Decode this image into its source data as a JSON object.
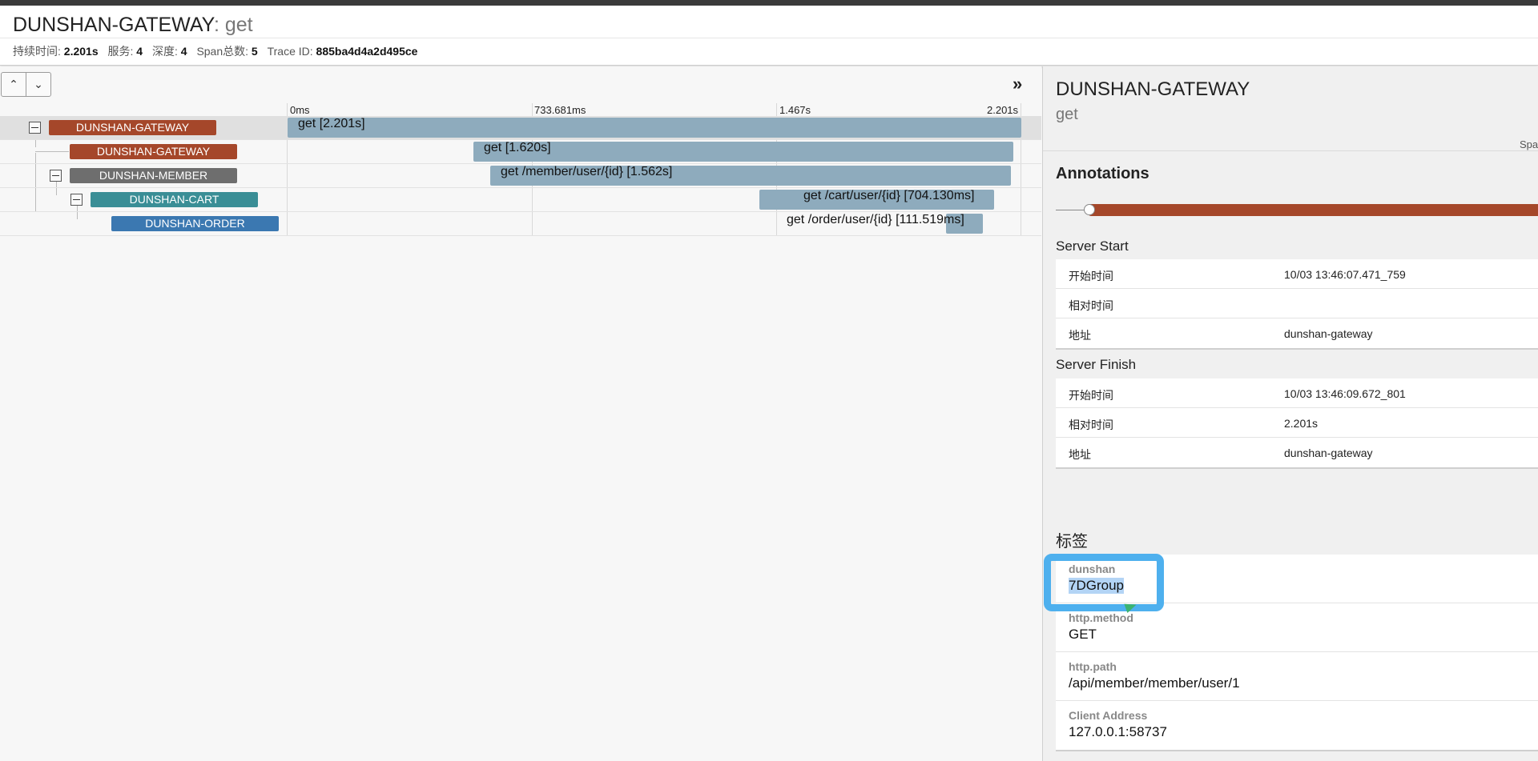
{
  "header": {
    "service": "DUNSHAN-GATEWAY",
    "operation": ": get",
    "stats": {
      "duration_label": "持续时间:",
      "duration": "2.201s",
      "services_label": "服务:",
      "services": "4",
      "depth_label": "深度:",
      "depth": "4",
      "spans_label": "Span总数:",
      "spans": "5",
      "traceid_label": "Trace ID:",
      "traceid": "885ba4d4a2d495ce"
    }
  },
  "controls": {
    "up_icon": "⌃",
    "down_icon": "⌄",
    "expand_icon": "»"
  },
  "timeline": {
    "ticks": [
      "0ms",
      "733.681ms",
      "1.467s",
      "2.201s"
    ]
  },
  "spans": [
    {
      "service": "DUNSHAN-GATEWAY",
      "label": "get [2.201s]",
      "color": "#a5472a"
    },
    {
      "service": "DUNSHAN-GATEWAY",
      "label": "get [1.620s]",
      "color": "#a5472a"
    },
    {
      "service": "DUNSHAN-MEMBER",
      "label": "get /member/user/{id} [1.562s]",
      "color": "#6e6e6e"
    },
    {
      "service": "DUNSHAN-CART",
      "label": "get /cart/user/{id} [704.130ms]",
      "color": "#3a8e96"
    },
    {
      "service": "DUNSHAN-ORDER",
      "label": "get /order/user/{id} [111.519ms]",
      "color": "#3b78b1"
    }
  ],
  "detail": {
    "title": "DUNSHAN-GATEWAY",
    "subtitle": "get",
    "spa": "Spa",
    "annotations_heading": "Annotations",
    "server_start": {
      "title": "Server Start",
      "rows": [
        {
          "k": "开始时间",
          "v": "10/03 13:46:07.471_759"
        },
        {
          "k": "相对时间",
          "v": ""
        },
        {
          "k": "地址",
          "v": "dunshan-gateway"
        }
      ]
    },
    "server_finish": {
      "title": "Server Finish",
      "rows": [
        {
          "k": "开始时间",
          "v": "10/03 13:46:09.672_801"
        },
        {
          "k": "相对时间",
          "v": "2.201s"
        },
        {
          "k": "地址",
          "v": "dunshan-gateway"
        }
      ]
    },
    "tags_heading": "标签",
    "tags": [
      {
        "k": "dunshan",
        "v": "7DGroup"
      },
      {
        "k": "http.method",
        "v": "GET"
      },
      {
        "k": "http.path",
        "v": "/api/member/member/user/1"
      },
      {
        "k": "Client Address",
        "v": "127.0.0.1:58737"
      }
    ]
  },
  "colors": {
    "bar": "#8eabbd",
    "callout": "#4eb0ee",
    "selection": "#b3d4f5"
  }
}
